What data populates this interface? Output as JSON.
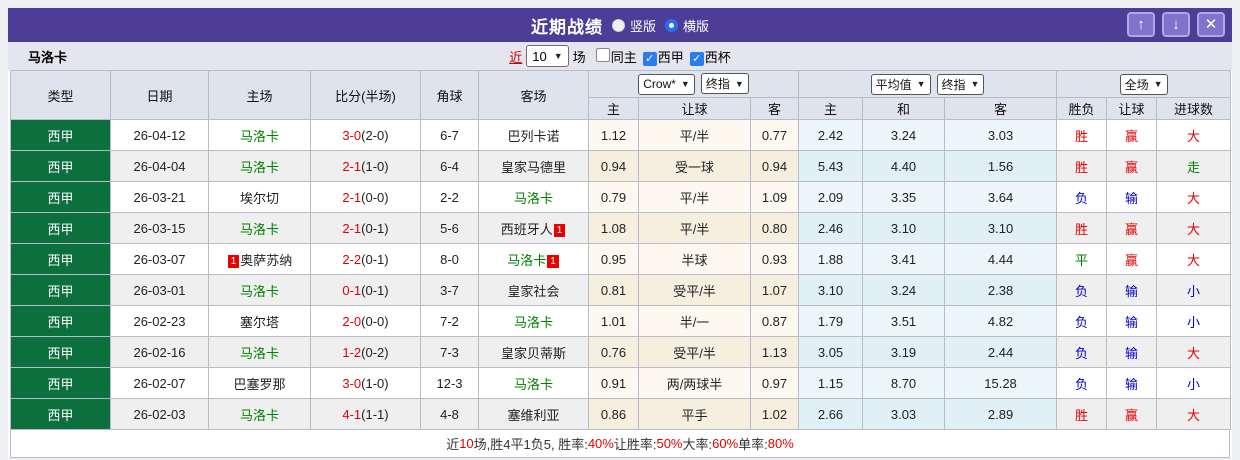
{
  "titlebar": {
    "title": "近期战绩",
    "radios": [
      {
        "label": "竖版",
        "selected": false
      },
      {
        "label": "横版",
        "selected": true
      }
    ],
    "buttons": {
      "up": "↑",
      "down": "↓",
      "close": "✕"
    }
  },
  "filter": {
    "team": "马洛卡",
    "near_label": "近",
    "count_value": "10",
    "unit_label": "场",
    "checkboxes": [
      {
        "label": "同主",
        "checked": false
      },
      {
        "label": "西甲",
        "checked": true
      },
      {
        "label": "西杯",
        "checked": true
      }
    ]
  },
  "table": {
    "static_headers": [
      "类型",
      "日期",
      "主场",
      "比分(半场)",
      "角球",
      "客场"
    ],
    "groups": [
      {
        "selects": [
          "Crow*",
          "终指"
        ],
        "cols": [
          "主",
          "让球",
          "客"
        ]
      },
      {
        "selects": [
          "平均值",
          "终指"
        ],
        "cols": [
          "主",
          "和",
          "客"
        ]
      },
      {
        "selects": [
          "全场"
        ],
        "cols": [
          "胜负",
          "让球",
          "进球数"
        ]
      }
    ],
    "rows": [
      {
        "type": "西甲",
        "date": "26-04-12",
        "home": "马洛卡",
        "homeGreen": true,
        "homeBadgePre": "",
        "score": "3-0",
        "half": "(2-0)",
        "corner": "6-7",
        "away": "巴列卡诺",
        "awayGreen": false,
        "awayBadgePost": "",
        "letHome": "1.12",
        "handicap": "平/半",
        "letAway": "0.77",
        "avgHome": "2.42",
        "avgDraw": "3.24",
        "avgAway": "3.03",
        "resWdl": "胜",
        "resWdlColor": "red",
        "resLet": "赢",
        "resLetColor": "red",
        "resGoal": "大",
        "resGoalColor": "red"
      },
      {
        "type": "西甲",
        "date": "26-04-04",
        "home": "马洛卡",
        "homeGreen": true,
        "homeBadgePre": "",
        "score": "2-1",
        "half": "(1-0)",
        "corner": "6-4",
        "away": "皇家马德里",
        "awayGreen": false,
        "awayBadgePost": "",
        "letHome": "0.94",
        "handicap": "受一球",
        "letAway": "0.94",
        "avgHome": "5.43",
        "avgDraw": "4.40",
        "avgAway": "1.56",
        "resWdl": "胜",
        "resWdlColor": "red",
        "resLet": "赢",
        "resLetColor": "red",
        "resGoal": "走",
        "resGoalColor": "green"
      },
      {
        "type": "西甲",
        "date": "26-03-21",
        "home": "埃尔切",
        "homeGreen": false,
        "homeBadgePre": "",
        "score": "2-1",
        "half": "(0-0)",
        "corner": "2-2",
        "away": "马洛卡",
        "awayGreen": true,
        "awayBadgePost": "",
        "letHome": "0.79",
        "handicap": "平/半",
        "letAway": "1.09",
        "avgHome": "2.09",
        "avgDraw": "3.35",
        "avgAway": "3.64",
        "resWdl": "负",
        "resWdlColor": "blue",
        "resLet": "输",
        "resLetColor": "blue",
        "resGoal": "大",
        "resGoalColor": "red"
      },
      {
        "type": "西甲",
        "date": "26-03-15",
        "home": "马洛卡",
        "homeGreen": true,
        "homeBadgePre": "",
        "score": "2-1",
        "half": "(0-1)",
        "corner": "5-6",
        "away": "西班牙人",
        "awayGreen": false,
        "awayBadgePost": "1",
        "letHome": "1.08",
        "handicap": "平/半",
        "letAway": "0.80",
        "avgHome": "2.46",
        "avgDraw": "3.10",
        "avgAway": "3.10",
        "resWdl": "胜",
        "resWdlColor": "red",
        "resLet": "赢",
        "resLetColor": "red",
        "resGoal": "大",
        "resGoalColor": "red"
      },
      {
        "type": "西甲",
        "date": "26-03-07",
        "home": "奥萨苏纳",
        "homeGreen": false,
        "homeBadgePre": "1",
        "score": "2-2",
        "half": "(0-1)",
        "corner": "8-0",
        "away": "马洛卡",
        "awayGreen": true,
        "awayBadgePost": "1",
        "letHome": "0.95",
        "handicap": "半球",
        "letAway": "0.93",
        "avgHome": "1.88",
        "avgDraw": "3.41",
        "avgAway": "4.44",
        "resWdl": "平",
        "resWdlColor": "green",
        "resLet": "赢",
        "resLetColor": "red",
        "resGoal": "大",
        "resGoalColor": "red"
      },
      {
        "type": "西甲",
        "date": "26-03-01",
        "home": "马洛卡",
        "homeGreen": true,
        "homeBadgePre": "",
        "score": "0-1",
        "half": "(0-1)",
        "corner": "3-7",
        "away": "皇家社会",
        "awayGreen": false,
        "awayBadgePost": "",
        "letHome": "0.81",
        "handicap": "受平/半",
        "letAway": "1.07",
        "avgHome": "3.10",
        "avgDraw": "3.24",
        "avgAway": "2.38",
        "resWdl": "负",
        "resWdlColor": "blue",
        "resLet": "输",
        "resLetColor": "blue",
        "resGoal": "小",
        "resGoalColor": "blue"
      },
      {
        "type": "西甲",
        "date": "26-02-23",
        "home": "塞尔塔",
        "homeGreen": false,
        "homeBadgePre": "",
        "score": "2-0",
        "half": "(0-0)",
        "corner": "7-2",
        "away": "马洛卡",
        "awayGreen": true,
        "awayBadgePost": "",
        "letHome": "1.01",
        "handicap": "半/一",
        "letAway": "0.87",
        "avgHome": "1.79",
        "avgDraw": "3.51",
        "avgAway": "4.82",
        "resWdl": "负",
        "resWdlColor": "blue",
        "resLet": "输",
        "resLetColor": "blue",
        "resGoal": "小",
        "resGoalColor": "blue"
      },
      {
        "type": "西甲",
        "date": "26-02-16",
        "home": "马洛卡",
        "homeGreen": true,
        "homeBadgePre": "",
        "score": "1-2",
        "half": "(0-2)",
        "corner": "7-3",
        "away": "皇家贝蒂斯",
        "awayGreen": false,
        "awayBadgePost": "",
        "letHome": "0.76",
        "handicap": "受平/半",
        "letAway": "1.13",
        "avgHome": "3.05",
        "avgDraw": "3.19",
        "avgAway": "2.44",
        "resWdl": "负",
        "resWdlColor": "blue",
        "resLet": "输",
        "resLetColor": "blue",
        "resGoal": "大",
        "resGoalColor": "red"
      },
      {
        "type": "西甲",
        "date": "26-02-07",
        "home": "巴塞罗那",
        "homeGreen": false,
        "homeBadgePre": "",
        "score": "3-0",
        "half": "(1-0)",
        "corner": "12-3",
        "away": "马洛卡",
        "awayGreen": true,
        "awayBadgePost": "",
        "letHome": "0.91",
        "handicap": "两/两球半",
        "letAway": "0.97",
        "avgHome": "1.15",
        "avgDraw": "8.70",
        "avgAway": "15.28",
        "resWdl": "负",
        "resWdlColor": "blue",
        "resLet": "输",
        "resLetColor": "blue",
        "resGoal": "小",
        "resGoalColor": "blue"
      },
      {
        "type": "西甲",
        "date": "26-02-03",
        "home": "马洛卡",
        "homeGreen": true,
        "homeBadgePre": "",
        "score": "4-1",
        "half": "(1-1)",
        "corner": "4-8",
        "away": "塞维利亚",
        "awayGreen": false,
        "awayBadgePost": "",
        "letHome": "0.86",
        "handicap": "平手",
        "letAway": "1.02",
        "avgHome": "2.66",
        "avgDraw": "3.03",
        "avgAway": "2.89",
        "resWdl": "胜",
        "resWdlColor": "red",
        "resLet": "赢",
        "resLetColor": "red",
        "resGoal": "大",
        "resGoalColor": "red"
      }
    ]
  },
  "footer": {
    "segments": [
      {
        "text": "近",
        "red": false
      },
      {
        "text": "10",
        "red": true
      },
      {
        "text": "场,胜4平1负5, 胜率:",
        "red": false
      },
      {
        "text": "40%",
        "red": true
      },
      {
        "text": " 让胜率:",
        "red": false
      },
      {
        "text": "50%",
        "red": true
      },
      {
        "text": " 大率:",
        "red": false
      },
      {
        "text": "60%",
        "red": true
      },
      {
        "text": " 单率:",
        "red": false
      },
      {
        "text": "80%",
        "red": true
      }
    ]
  },
  "colors": {
    "titlebar_purple": "#4e3d97",
    "league_green": "#0b6f3e",
    "team_green": "#008000",
    "result_red": "#e60000",
    "result_blue": "#0000cc",
    "handicap_col_bg": "#fdf9f0",
    "average_col_bg": "#edf6fa",
    "header_bg": "#dfe3ed"
  }
}
